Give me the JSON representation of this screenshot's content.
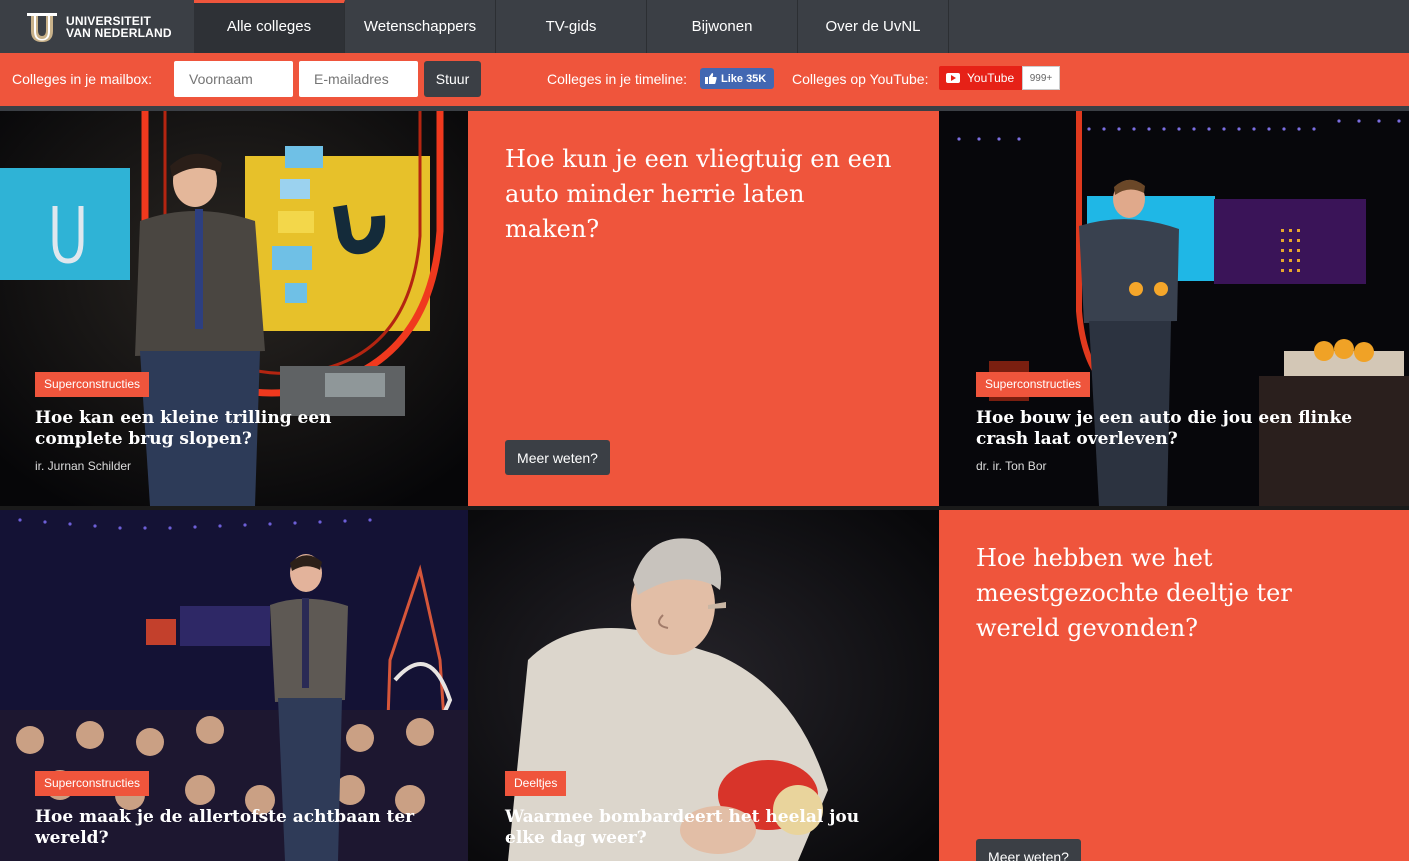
{
  "brand": {
    "line1": "UNIVERSITEIT",
    "line2": "VAN NEDERLAND"
  },
  "nav": [
    "Alle colleges",
    "Wetenschappers",
    "TV-gids",
    "Bijwonen",
    "Over de UvNL"
  ],
  "subscribe": {
    "mail_label": "Colleges in je mailbox:",
    "first_name_placeholder": "Voornaam",
    "email_placeholder": "E-mailadres",
    "submit_label": "Stuur",
    "timeline_label": "Colleges in je timeline:",
    "like_label": "Like 35K",
    "youtube_label": "Colleges op YouTube:",
    "youtube_button": "YouTube",
    "youtube_count": "999+"
  },
  "tiles": [
    {
      "tag": "Superconstructies",
      "title": "Hoe kan een kleine trilling een complete brug slopen?",
      "author": "ir. Jurnan Schilder"
    },
    {
      "question": "Hoe kun je een vliegtuig en een auto minder herrie laten maken?",
      "button": "Meer weten?"
    },
    {
      "tag": "Superconstructies",
      "title": "Hoe bouw je een auto die jou een flinke crash laat overleven?",
      "author": "dr. ir. Ton Bor"
    },
    {
      "tag": "Superconstructies",
      "title": "Hoe maak je de allertofste achtbaan ter wereld?"
    },
    {
      "tag": "Deeltjes",
      "title": "Waarmee bombardeert het heelal jou elke dag weer?"
    },
    {
      "question": "Hoe hebben we het meestgezochte deeltje ter wereld gevonden?",
      "button": "Meer weten?"
    }
  ],
  "colors": {
    "accent": "#ef553c",
    "nav": "#3b3f45",
    "facebook": "#4267b2",
    "youtube": "#e62117"
  }
}
